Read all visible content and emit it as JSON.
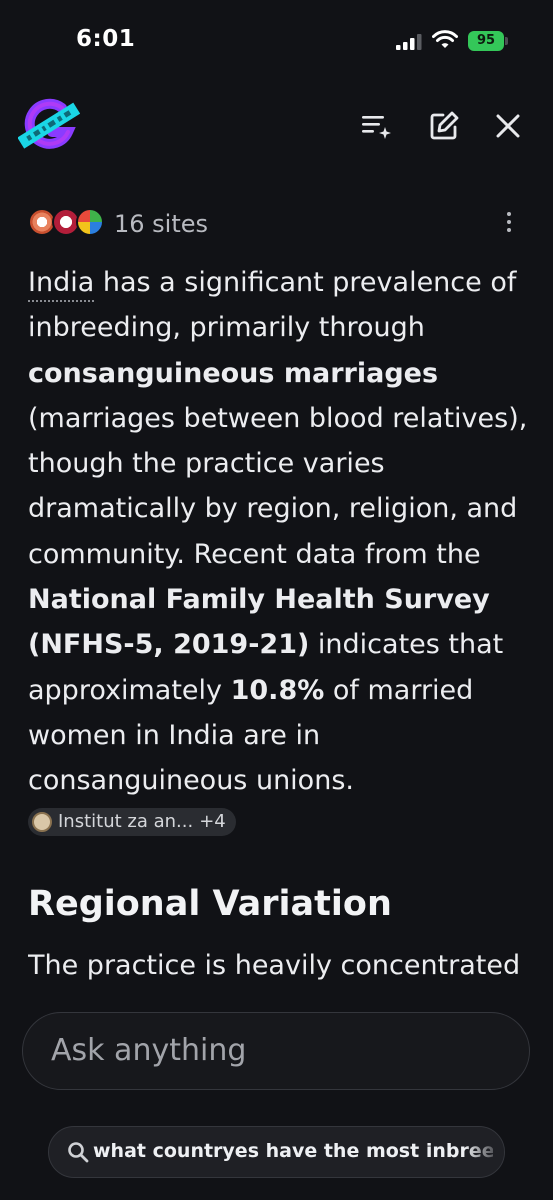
{
  "status_bar": {
    "time": "6:01",
    "battery": "95"
  },
  "header": {
    "logo_icon": "app-logo-icon",
    "actions": [
      {
        "icon": "playlist-sparkle-icon"
      },
      {
        "icon": "edit-icon"
      },
      {
        "icon": "close-icon"
      }
    ]
  },
  "sources": {
    "count_label": "16 sites"
  },
  "answer": {
    "entity": "India",
    "p1_a": " has a significant prevalence of inbreeding, primarily through ",
    "b1": "consanguineous marriages",
    "p1_b": " (marriages between blood relatives), though the practice varies dramatically by region, religion, and community. Recent data from the ",
    "b2": "National Family Health Survey (NFHS-5, 2019-21)",
    "p1_c": " indicates that approximately ",
    "b3": "10.8%",
    "p1_d": " of married women in India are in consanguineous unions. ",
    "citation_label": "Institut za an...",
    "citation_more": "+4"
  },
  "section": {
    "heading": "Regional Variation",
    "text": "The practice is heavily concentrated"
  },
  "input": {
    "placeholder": "Ask anything"
  },
  "query_chip": {
    "text": "what countryes have the most inbreedi"
  },
  "colors": {
    "background": "#111216",
    "battery": "#34c759",
    "logo_cyan": "#1ad6e6",
    "logo_purple": "#8a3bff"
  }
}
